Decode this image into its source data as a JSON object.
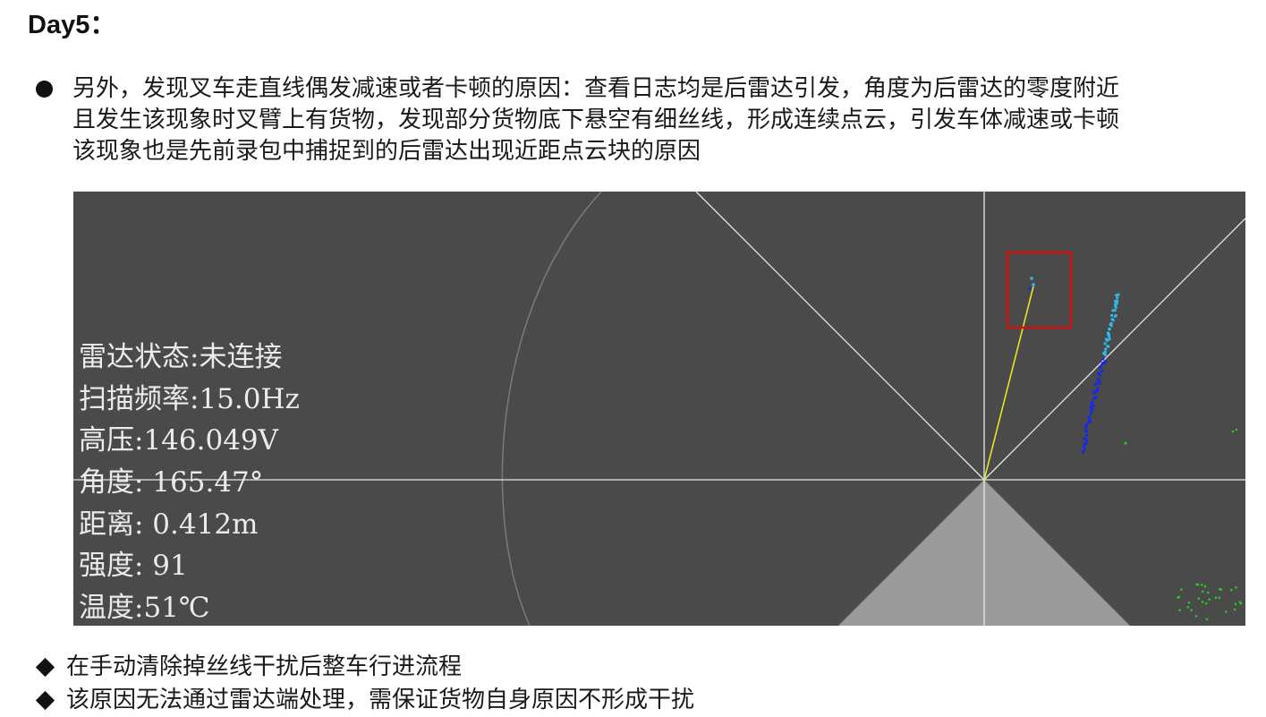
{
  "title": "Day5：",
  "paragraph": {
    "lines": [
      "另外，发现叉车走直线偶发减速或者卡顿的原因：查看日志均是后雷达引发，角度为后雷达的零度附近",
      "且发生该现象时叉臂上有货物，发现部分货物底下悬空有细丝线，形成连续点云，引发车体减速或卡顿",
      "该现象也是先前录包中捕捉到的后雷达出现近距点云块的原因"
    ]
  },
  "radar": {
    "status_lines": [
      "雷达状态:未连接",
      "扫描频率:15.0Hz",
      "高压:146.049V",
      "角度: 165.47°",
      "距离: 0.412m",
      "强度: 91",
      "温度:51℃"
    ],
    "colors": {
      "background": "#4a4a4a",
      "grid": "#e6e6e6",
      "beam": "#e5e521",
      "highlight_box": "#d01010",
      "blind_zone": "#9a9a9a",
      "points_blue": "#1a2be0",
      "points_cyan": "#2fb8e8",
      "points_green": "#22cc22"
    }
  },
  "bullets": [
    "在手动清除掉丝线干扰后整车行进流程",
    "该原因无法通过雷达端处理，需保证货物自身原因不形成干扰"
  ]
}
